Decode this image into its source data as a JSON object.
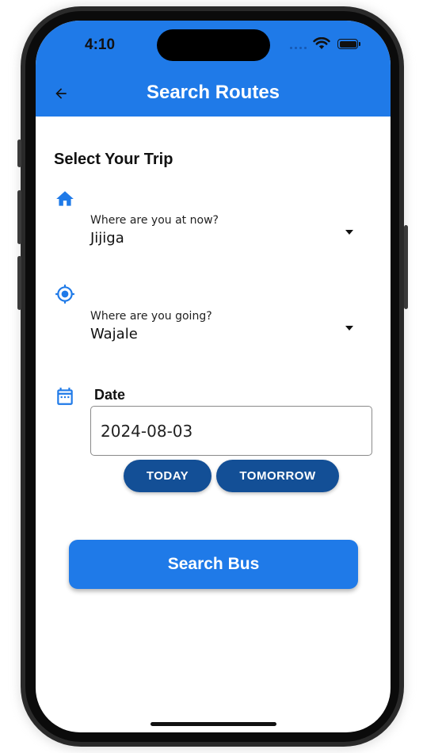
{
  "status_bar": {
    "time": "4:10"
  },
  "appbar": {
    "title": "Search Routes"
  },
  "form": {
    "section_title": "Select Your Trip",
    "origin": {
      "label": "Where are you at now?",
      "value": "Jijiga"
    },
    "destination": {
      "label": "Where are you going?",
      "value": "Wajale"
    },
    "date": {
      "label": "Date",
      "value": "2024-08-03",
      "quick_options": [
        "TODAY",
        "TOMORROW"
      ]
    },
    "submit_label": "Search Bus"
  },
  "icons": {
    "origin": "home-icon",
    "destination": "my-location-icon",
    "date": "calendar-icon",
    "back": "arrow-back-icon"
  },
  "colors": {
    "primary": "#1f7ae8",
    "secondary": "#134f96",
    "icon": "#1f7ae8"
  }
}
